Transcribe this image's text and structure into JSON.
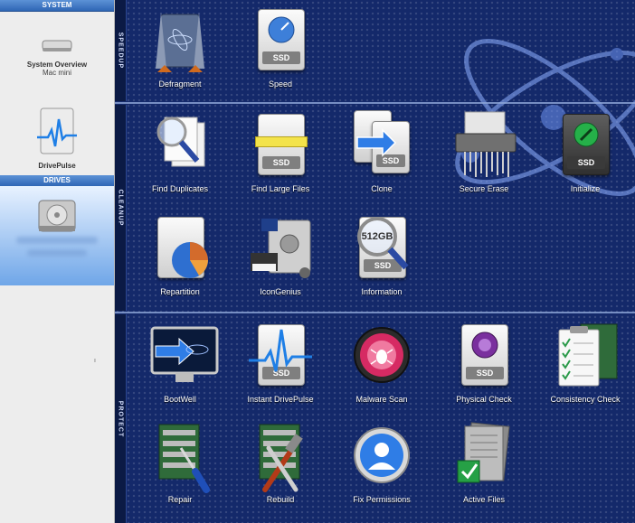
{
  "sidebar": {
    "system_header": "SYSTEM",
    "system_overview": {
      "title": "System Overview",
      "subtitle": "Mac mini"
    },
    "drivepulse": {
      "title": "DrivePulse"
    },
    "drives_header": "DRIVES",
    "splitter_mark": "ı"
  },
  "groups": {
    "speedup": "SPEEDUP",
    "cleanup": "CLEANUP",
    "protect": "PROTECT"
  },
  "tools": {
    "defragment": "Defragment",
    "speed": "Speed",
    "find_duplicates": "Find Duplicates",
    "find_large_files": "Find Large Files",
    "clone": "Clone",
    "secure_erase": "Secure Erase",
    "initialize": "Initialize",
    "repartition": "Repartition",
    "icongenius": "IconGenius",
    "information": "Information",
    "bootwell": "BootWell",
    "instant_drivepulse": "Instant DrivePulse",
    "malware_scan": "Malware Scan",
    "physical_check": "Physical Check",
    "consistency_check": "Consistency Check",
    "repair": "Repair",
    "rebuild": "Rebuild",
    "fix_permissions": "Fix Permissions",
    "active_files": "Active Files"
  },
  "icon_text": {
    "ssd": "SSD",
    "capacity": "512GB"
  },
  "colors": {
    "background": "#14296a",
    "sidebar_header": "#3a72c0",
    "selection": "#6fa6e8"
  }
}
